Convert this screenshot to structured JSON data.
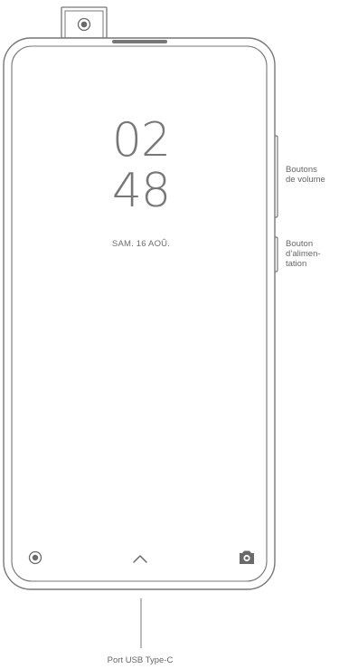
{
  "lock_screen": {
    "clock_hours": "02",
    "clock_minutes": "48",
    "date": "SAM. 16 AOÛ."
  },
  "callouts": {
    "volume_line1": "Boutons",
    "volume_line2": "de volume",
    "power_line1": "Bouton",
    "power_line2": "d’alimen-",
    "power_line3": "tation",
    "usb_port": "Port USB Type-C"
  },
  "icons": {
    "pop_up_camera": "pop-up-camera-icon",
    "lock_screen_left": "record-circle-icon",
    "swipe_up": "chevron-up-icon",
    "lock_screen_right": "camera-icon"
  },
  "colors": {
    "outline": "#777777",
    "text": "#6f6f6f",
    "background": "#ffffff"
  }
}
